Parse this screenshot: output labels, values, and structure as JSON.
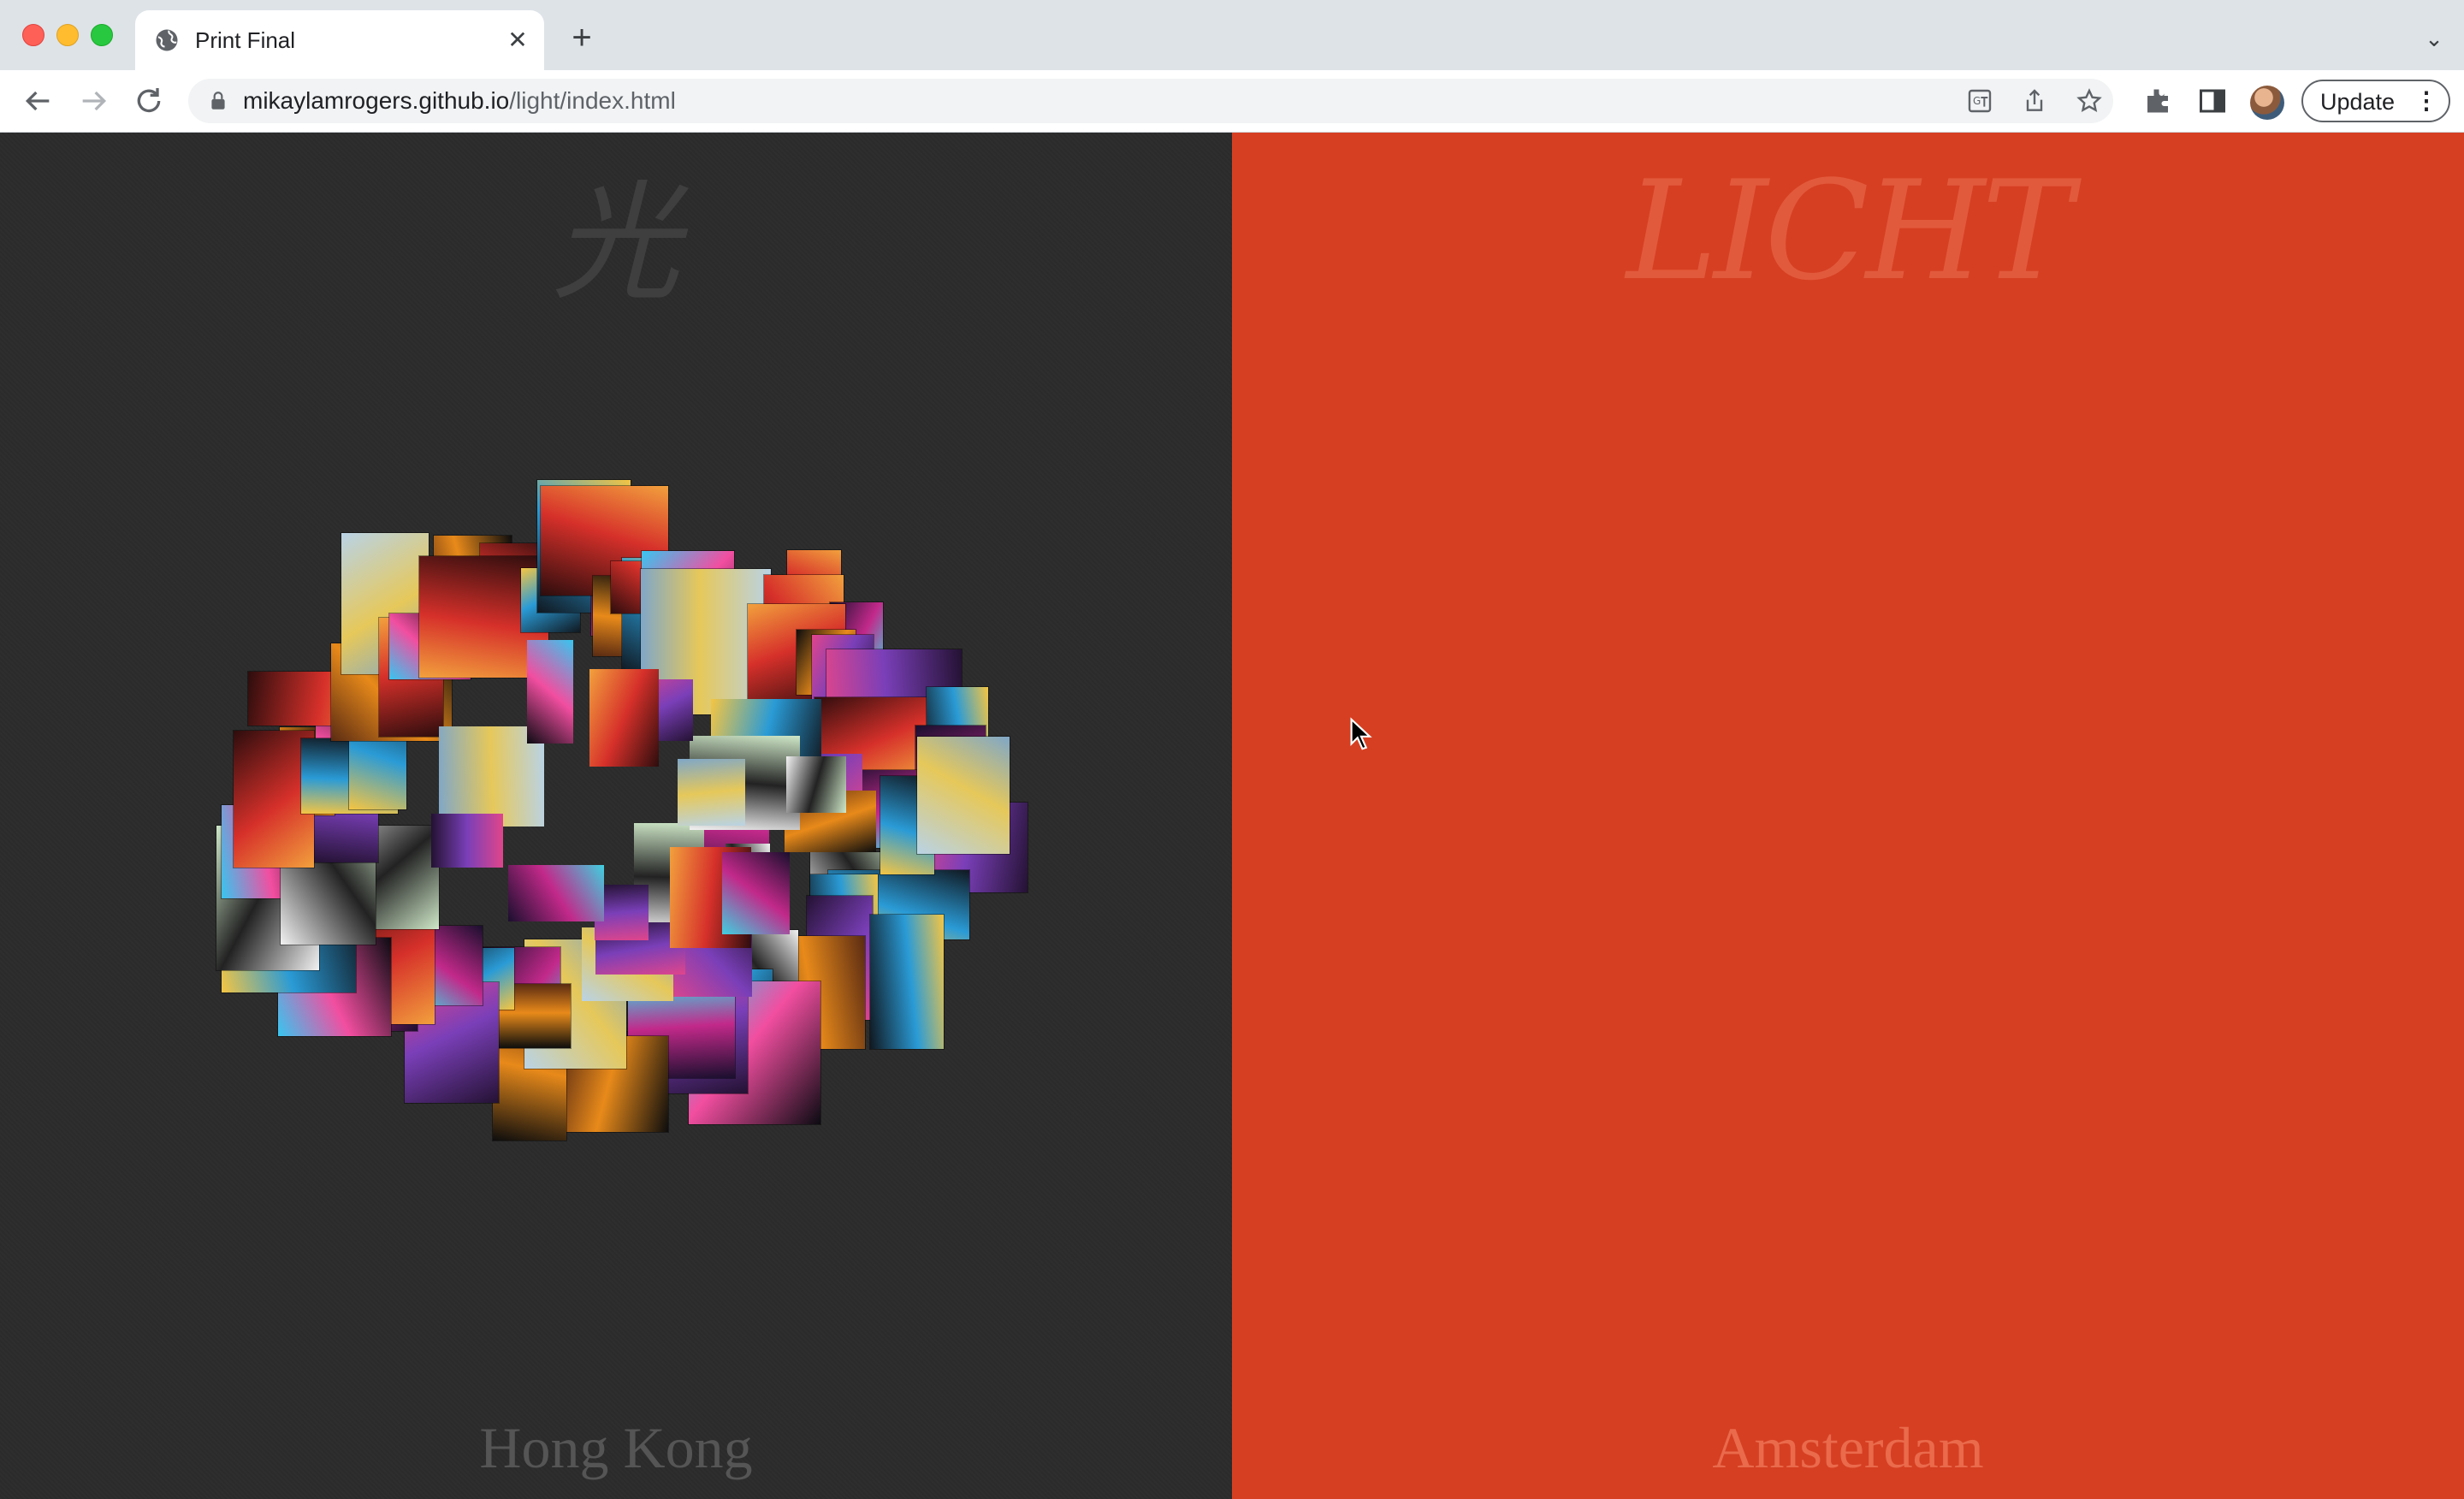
{
  "browser": {
    "tab_title": "Print Final",
    "url_domain": "mikaylamrogers.github.io",
    "url_path": "/light/index.html",
    "update_label": "Update",
    "icons": [
      "globe-icon",
      "close-icon",
      "plus-icon",
      "chevron-down-icon",
      "back-icon",
      "forward-icon",
      "reload-icon",
      "lock-icon",
      "translate-icon",
      "share-icon",
      "star-icon",
      "extensions-icon",
      "side-panel-icon",
      "avatar",
      "more-icon"
    ]
  },
  "page": {
    "left": {
      "title": "光",
      "city": "Hong Kong",
      "background": "#2b2b2b"
    },
    "right": {
      "title": "LICHT",
      "city": "Amsterdam",
      "background": "#d63f22"
    }
  }
}
